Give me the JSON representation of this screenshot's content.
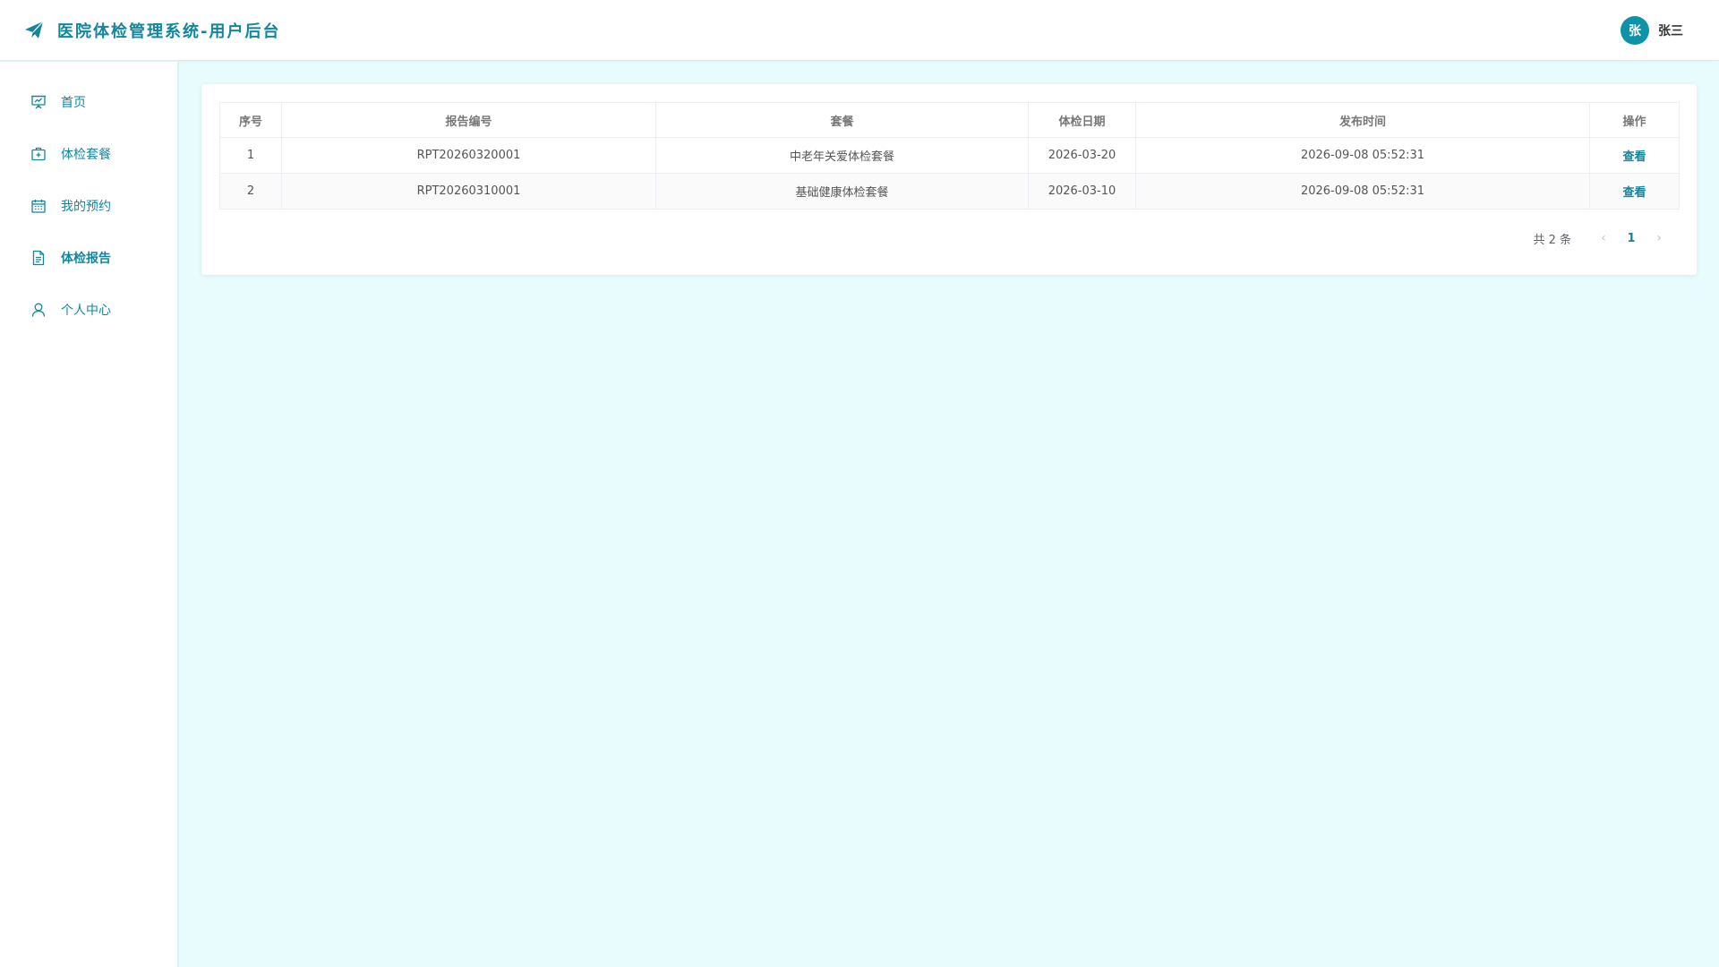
{
  "app": {
    "title": "医院体检管理系统-用户后台",
    "brand_color": "#13869e",
    "icon": "paper-plane-icon"
  },
  "user": {
    "avatar_initial": "张",
    "name": "张三"
  },
  "sidebar": {
    "items": [
      {
        "label": "首页",
        "icon": "presentation-board-icon",
        "active": false
      },
      {
        "label": "体检套餐",
        "icon": "medical-kit-icon",
        "active": false
      },
      {
        "label": "我的预约",
        "icon": "calendar-icon",
        "active": false
      },
      {
        "label": "体检报告",
        "icon": "document-icon",
        "active": true
      },
      {
        "label": "个人中心",
        "icon": "user-icon",
        "active": false
      }
    ]
  },
  "table": {
    "headers": [
      "序号",
      "报告编号",
      "套餐",
      "体检日期",
      "发布时间",
      "操作"
    ],
    "rows": [
      {
        "index": "1",
        "report_no": "RPT20260320001",
        "package": "中老年关爱体检套餐",
        "exam_date": "2026-03-20",
        "publish_time": "2026-09-08 05:52:31",
        "action": "查看"
      },
      {
        "index": "2",
        "report_no": "RPT20260310001",
        "package": "基础健康体检套餐",
        "exam_date": "2026-03-10",
        "publish_time": "2026-09-08 05:52:31",
        "action": "查看"
      }
    ]
  },
  "pagination": {
    "total_label": "共 2 条",
    "current_page": "1",
    "prev_icon": "chevron-left-icon",
    "next_icon": "chevron-right-icon"
  }
}
